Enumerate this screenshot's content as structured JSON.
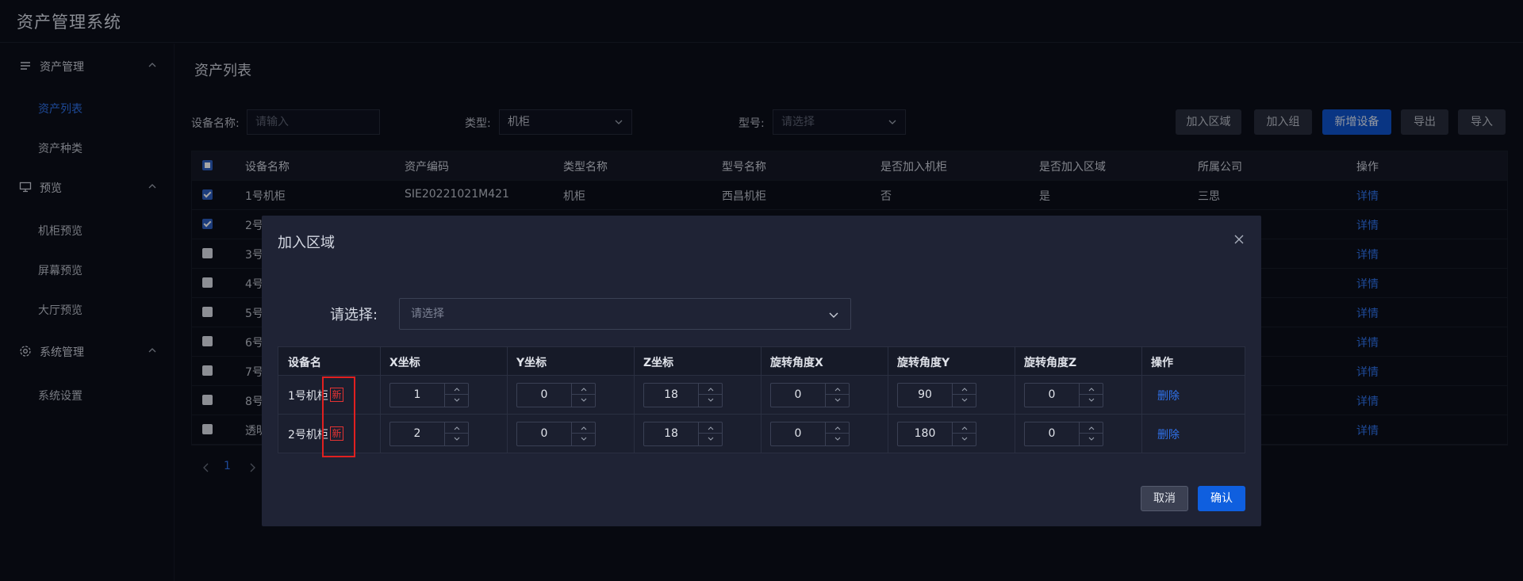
{
  "app": {
    "title": "资产管理系统"
  },
  "sidebar": {
    "groups": [
      {
        "label": "资产管理",
        "icon": "list-icon",
        "items": [
          {
            "label": "资产列表",
            "active": true
          },
          {
            "label": "资产种类",
            "active": false
          }
        ]
      },
      {
        "label": "预览",
        "icon": "monitor-icon",
        "items": [
          {
            "label": "机柜预览",
            "active": false
          },
          {
            "label": "屏幕预览",
            "active": false
          },
          {
            "label": "大厅预览",
            "active": false
          }
        ]
      },
      {
        "label": "系统管理",
        "icon": "gear-icon",
        "items": [
          {
            "label": "系统设置",
            "active": false
          }
        ]
      }
    ]
  },
  "main": {
    "title": "资产列表",
    "filters": {
      "name_label": "设备名称:",
      "name_placeholder": "请输入",
      "type_label": "类型:",
      "type_value": "机柜",
      "model_label": "型号:",
      "model_placeholder": "请选择"
    },
    "toolbar": {
      "add_area": "加入区域",
      "add_group": "加入组",
      "new_device": "新增设备",
      "export": "导出",
      "import": "导入"
    },
    "table": {
      "columns": [
        "设备名称",
        "资产编码",
        "类型名称",
        "型号名称",
        "是否加入机柜",
        "是否加入区域",
        "所属公司",
        "操作"
      ],
      "rows": [
        {
          "name": "1号机柜",
          "code": "SIE20221021M421",
          "type": "机柜",
          "model": "西昌机柜",
          "in_cabinet": "否",
          "in_area": "是",
          "company": "三思",
          "action": "详情",
          "checked": true
        },
        {
          "name": "2号",
          "checked": true,
          "action": "详情"
        },
        {
          "name": "3号",
          "checked": false,
          "action": "详情"
        },
        {
          "name": "4号",
          "checked": false,
          "action": "详情"
        },
        {
          "name": "5号",
          "checked": false,
          "action": "详情"
        },
        {
          "name": "6号",
          "checked": false,
          "action": "详情"
        },
        {
          "name": "7号",
          "checked": false,
          "action": "详情"
        },
        {
          "name": "8号",
          "checked": false,
          "action": "详情"
        },
        {
          "name": "透明",
          "checked": false,
          "action": "详情"
        }
      ]
    },
    "pager": {
      "current": "1"
    }
  },
  "dialog": {
    "title": "加入区域",
    "select_label": "请选择:",
    "select_placeholder": "请选择",
    "columns": [
      "设备名",
      "X坐标",
      "Y坐标",
      "Z坐标",
      "旋转角度X",
      "旋转角度Y",
      "旋转角度Z",
      "操作"
    ],
    "rows": [
      {
        "name": "1号机柜",
        "badge": "新",
        "x": "1",
        "y": "0",
        "z": "18",
        "rx": "0",
        "ry": "90",
        "rz": "0",
        "action": "删除"
      },
      {
        "name": "2号机柜",
        "badge": "新",
        "x": "2",
        "y": "0",
        "z": "18",
        "rx": "0",
        "ry": "180",
        "rz": "0",
        "action": "删除"
      }
    ],
    "cancel": "取消",
    "confirm": "确认"
  },
  "colors": {
    "accent": "#2f71e8",
    "primary_button": "#0f5fdf",
    "badge_red": "#e53333",
    "background": "#0b0e19",
    "dialog_bg": "#1f2335"
  }
}
